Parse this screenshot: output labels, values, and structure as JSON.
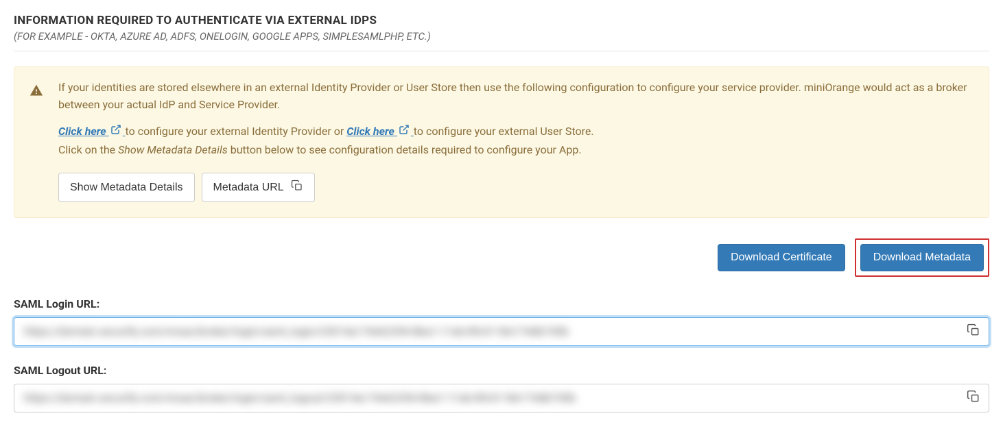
{
  "header": {
    "title": "INFORMATION REQUIRED TO AUTHENTICATE VIA EXTERNAL IDPS",
    "subtitle": "(FOR EXAMPLE - OKTA, AZURE AD, ADFS, ONELOGIN, GOOGLE APPS, SIMPLESAMLPHP, ETC.)"
  },
  "alert": {
    "intro": "If your identities are stored elsewhere in an external Identity Provider or User Store then use the following configuration to configure your service provider. miniOrange would act as a broker between your actual IdP and Service Provider.",
    "click_here_1": "Click here",
    "after_link_1": " to configure your external Identity Provider or ",
    "click_here_2": "Click here",
    "after_link_2": " to configure your external User Store.",
    "line3_pre": "Click on the ",
    "line3_em": "Show Metadata Details",
    "line3_post": " button below to see configuration details required to configure your App.",
    "btn_show_metadata": "Show Metadata Details",
    "btn_metadata_url": "Metadata URL"
  },
  "downloads": {
    "certificate": "Download Certificate",
    "metadata": "Download Metadata"
  },
  "fields": {
    "login_label": "SAML Login URL:",
    "login_value": "https://domain.xecurify.com/moas/broker/login/saml_login/23014e/19e62354-8ba1-11eb-89c9-18e174db745b",
    "logout_label": "SAML Logout URL:",
    "logout_value": "https://domain.xecurify.com/moas/broker/login/saml_logout/23014e/19e62354-8ba1-11eb-89c9-18e174db745b"
  }
}
